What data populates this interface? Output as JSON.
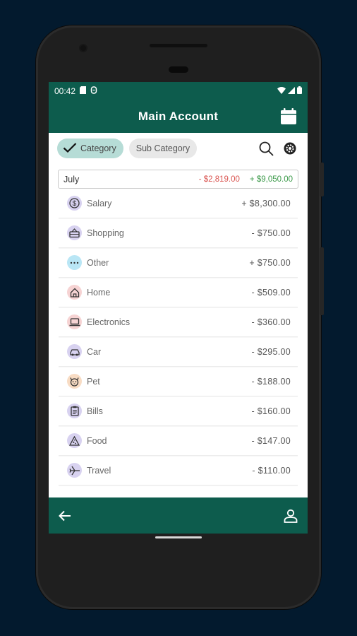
{
  "status": {
    "time": "00:42"
  },
  "header": {
    "title": "Main Account"
  },
  "filters": {
    "category_label": "Category",
    "subcategory_label": "Sub Category"
  },
  "summary": {
    "month": "July",
    "expense": "- $2,819.00",
    "income": "+ $9,050.00"
  },
  "categories": [
    {
      "name": "Salary",
      "amount": "+ $8,300.00",
      "icon": "dollar-icon",
      "color": "#d8d2f0"
    },
    {
      "name": "Shopping",
      "amount": "- $750.00",
      "icon": "basket-icon",
      "color": "#d8d2f0"
    },
    {
      "name": "Other",
      "amount": "+ $750.00",
      "icon": "more-dots-icon",
      "color": "#b9e6f5"
    },
    {
      "name": "Home",
      "amount": "- $509.00",
      "icon": "house-icon",
      "color": "#f6d3d3"
    },
    {
      "name": "Electronics",
      "amount": "- $360.00",
      "icon": "laptop-icon",
      "color": "#f6d3d3"
    },
    {
      "name": "Car",
      "amount": "- $295.00",
      "icon": "car-icon",
      "color": "#d8d2f0"
    },
    {
      "name": "Pet",
      "amount": "- $188.00",
      "icon": "pet-icon",
      "color": "#f8dcc4"
    },
    {
      "name": "Bills",
      "amount": "- $160.00",
      "icon": "clipboard-icon",
      "color": "#d8d2f0"
    },
    {
      "name": "Food",
      "amount": "- $147.00",
      "icon": "pizza-icon",
      "color": "#d8d2f0"
    },
    {
      "name": "Travel",
      "amount": "- $110.00",
      "icon": "airplane-icon",
      "color": "#d8d2f0"
    }
  ]
}
